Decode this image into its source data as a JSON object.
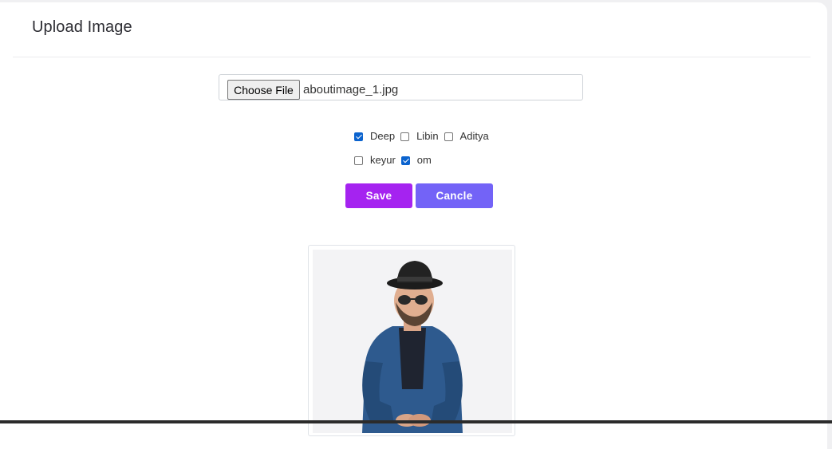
{
  "card": {
    "title": "Upload Image"
  },
  "file_input": {
    "button_label": "Choose File",
    "file_name": "aboutimage_1.jpg"
  },
  "checkboxes": [
    {
      "label": "Deep",
      "checked": true
    },
    {
      "label": "Libin",
      "checked": false
    },
    {
      "label": "Aditya",
      "checked": false
    },
    {
      "label": "keyur",
      "checked": false
    },
    {
      "label": "om",
      "checked": true
    }
  ],
  "actions": {
    "save_label": "Save",
    "cancel_label": "Cancle"
  },
  "colors": {
    "save": "#a523f0",
    "cancel": "#7363f7",
    "checkbox_checked": "#0b63ce"
  }
}
